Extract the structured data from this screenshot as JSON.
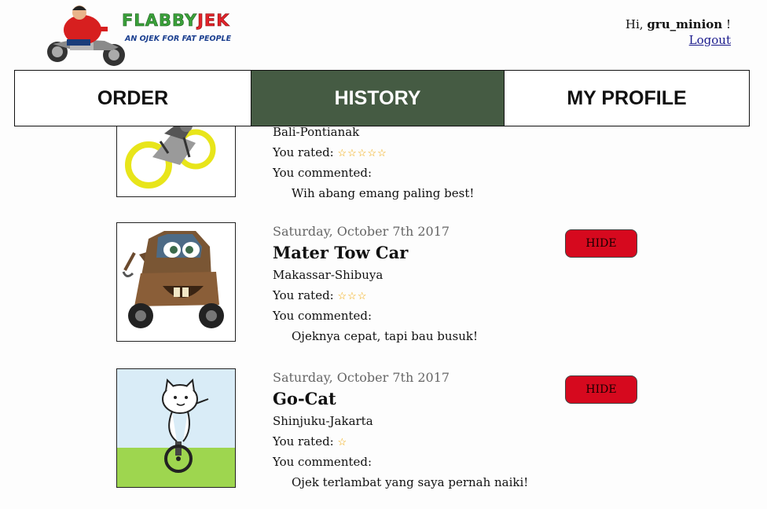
{
  "brand": {
    "name_part1": "FLABBY",
    "name_part2": "JEK",
    "tagline": "AN OJEK FOR FAT PEOPLE"
  },
  "user": {
    "greeting_prefix": "Hi, ",
    "username": "gru_minion",
    "greeting_suffix": " !",
    "logout_label": "Logout"
  },
  "nav": {
    "tabs": [
      {
        "label": "ORDER",
        "active": false
      },
      {
        "label": "HISTORY",
        "active": true
      },
      {
        "label": "MY PROFILE",
        "active": false
      }
    ]
  },
  "history": {
    "rated_label": "You rated:",
    "commented_label": "You commented:",
    "hide_label": "HIDE",
    "items": [
      {
        "image": "motorbike-rider-image",
        "route": "Bali-Pontianak",
        "stars": "☆☆☆☆☆",
        "comment": "Wih abang emang paling best!"
      },
      {
        "image": "tow-truck-image",
        "date": "Saturday, October 7th 2017",
        "driver": "Mater Tow Car",
        "route": "Makassar-Shibuya",
        "stars": "☆☆☆",
        "comment": "Ojeknya cepat, tapi bau busuk!"
      },
      {
        "image": "cat-unicycle-image",
        "date": "Saturday, October 7th 2017",
        "driver": "Go-Cat",
        "route": "Shinjuku-Jakarta",
        "stars": "☆",
        "comment": "Ojek terlambat yang saya pernah naiki!"
      }
    ]
  },
  "colors": {
    "active_tab": "#455b43",
    "hide_button": "#d6091e",
    "star": "#f0a500"
  }
}
